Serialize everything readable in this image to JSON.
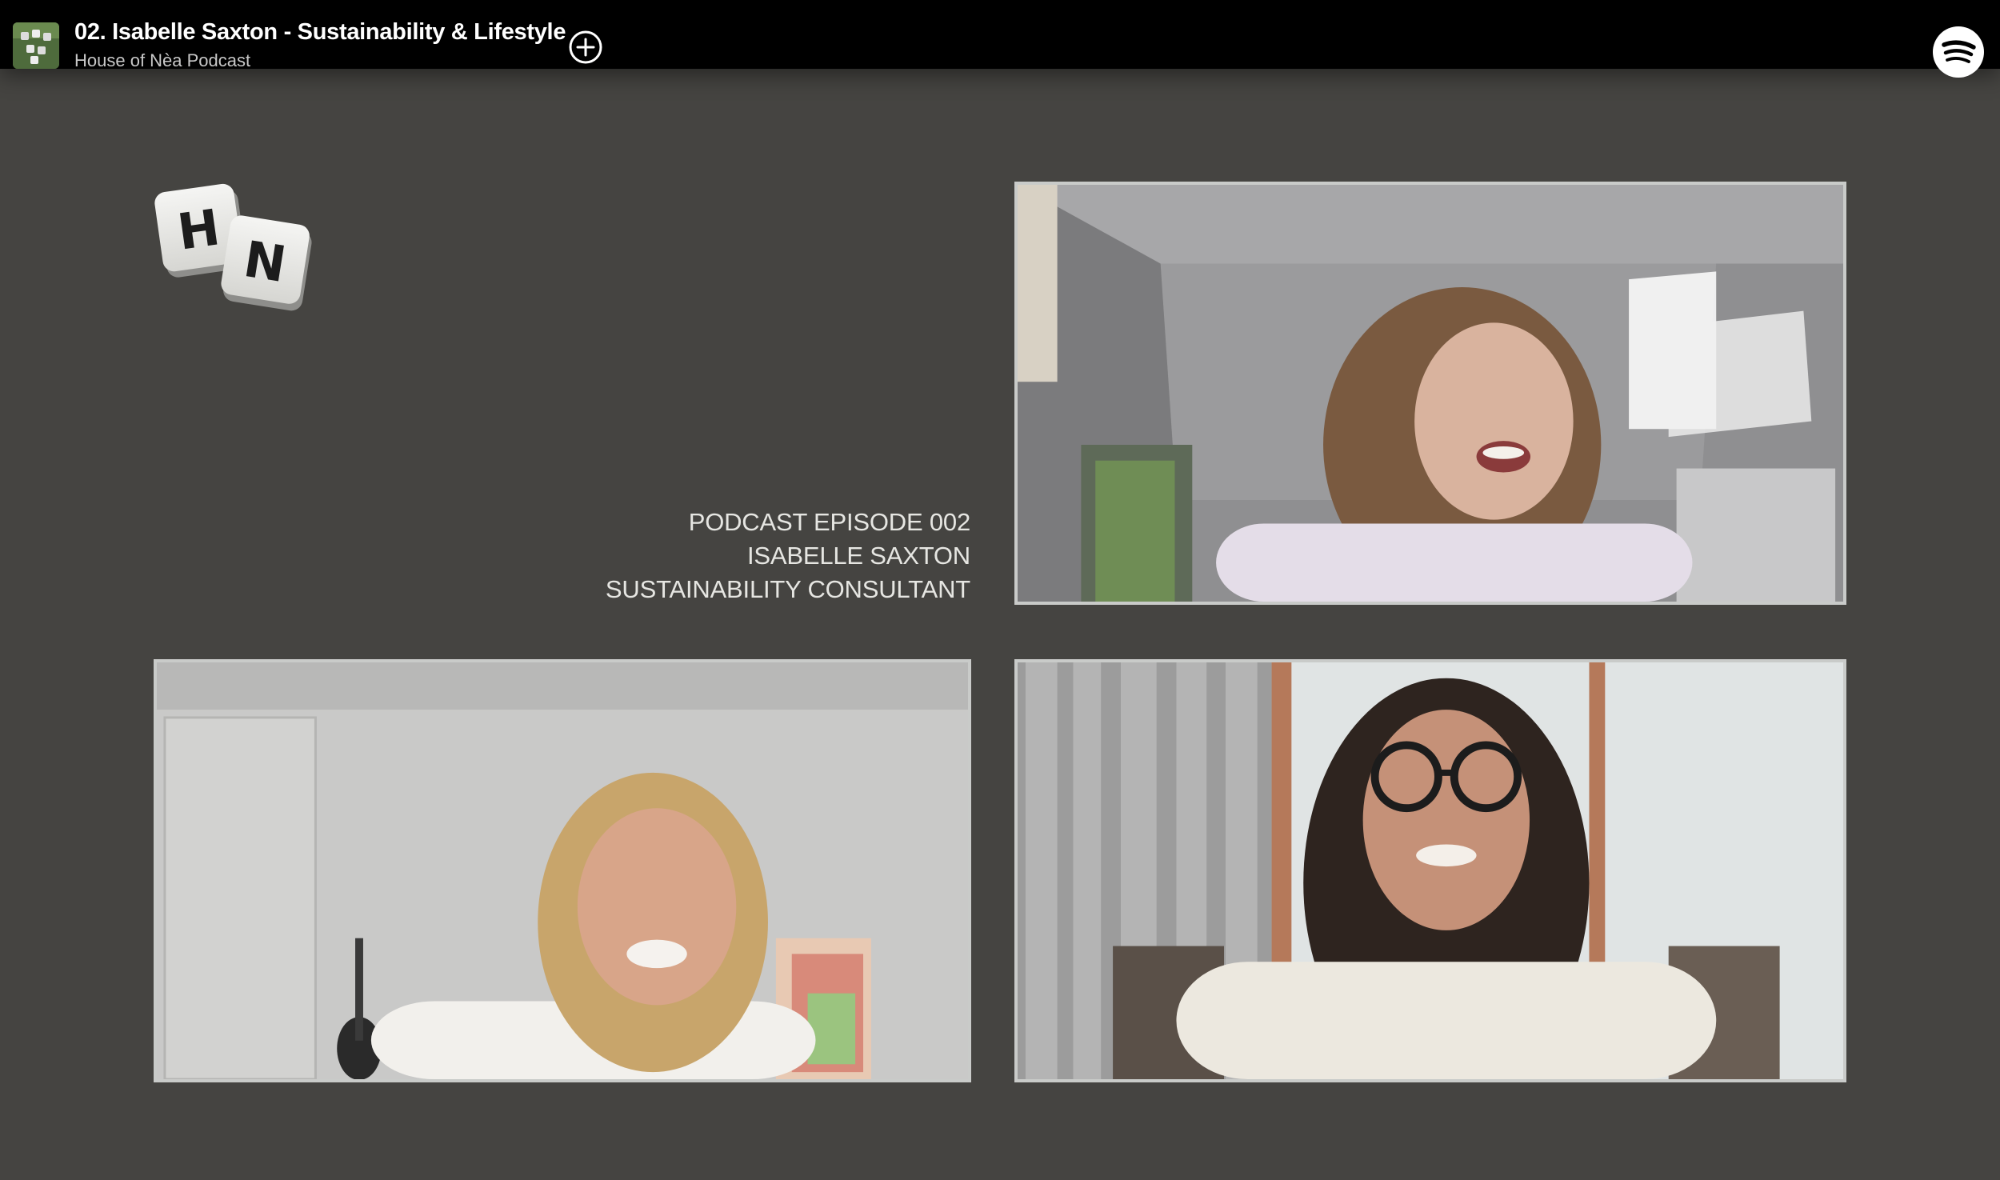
{
  "player_bar": {
    "episode_title": "02. Isabelle Saxton - Sustainability & Lifestyle",
    "show_name": "House of Nèa Podcast",
    "add_icon": "plus-circle-icon",
    "brand_icon": "spotify-logo-icon"
  },
  "branding": {
    "logo_letters": [
      "H",
      "N"
    ]
  },
  "episode_info": {
    "line1": "PODCAST EPISODE 002",
    "line2": "ISABELLE SAXTON",
    "line3": "SUSTAINABILITY CONSULTANT"
  },
  "colors": {
    "background": "#454441",
    "topbar": "#000000",
    "tile_border": "#c9cbc9",
    "info_text": "#e6e6e2"
  }
}
